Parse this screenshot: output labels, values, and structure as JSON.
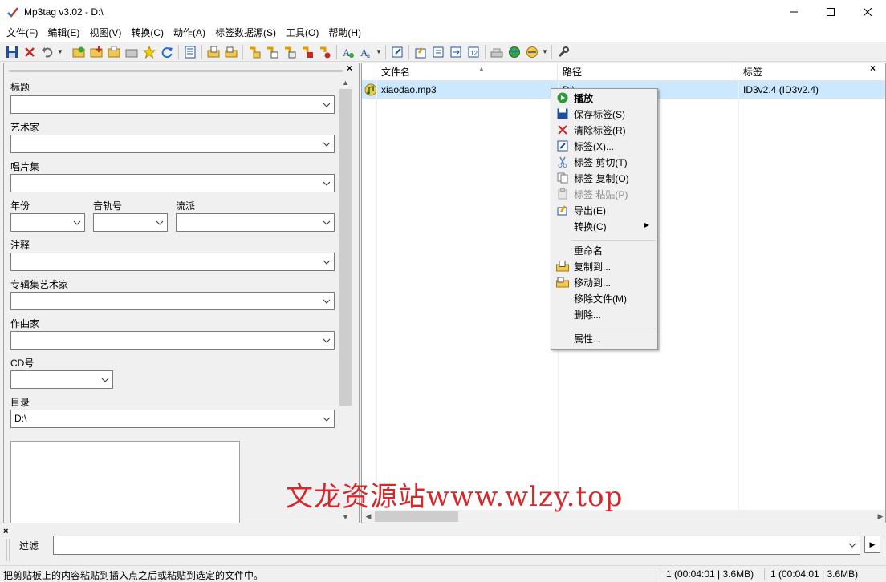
{
  "window": {
    "title": "Mp3tag v3.02  -  D:\\",
    "minimize": "—",
    "maximize": "☐",
    "close": "✕"
  },
  "menu": [
    "文件(F)",
    "编辑(E)",
    "视图(V)",
    "转换(C)",
    "动作(A)",
    "标签数据源(S)",
    "工具(O)",
    "帮助(H)"
  ],
  "tag_panel": {
    "close": "×",
    "fields": {
      "title": {
        "label": "标题",
        "value": ""
      },
      "artist": {
        "label": "艺术家",
        "value": ""
      },
      "album": {
        "label": "唱片集",
        "value": ""
      },
      "year": {
        "label": "年份",
        "value": ""
      },
      "track": {
        "label": "音轨号",
        "value": ""
      },
      "genre": {
        "label": "流派",
        "value": ""
      },
      "comment": {
        "label": "注释",
        "value": ""
      },
      "album_artist": {
        "label": "专辑集艺术家",
        "value": ""
      },
      "composer": {
        "label": "作曲家",
        "value": ""
      },
      "disc": {
        "label": "CD号",
        "value": ""
      },
      "directory": {
        "label": "目录",
        "value": "D:\\"
      }
    }
  },
  "file_list": {
    "close": "×",
    "columns": [
      "文件名",
      "路径",
      "标签"
    ],
    "rows": [
      {
        "filename": "xiaodao.mp3",
        "path": "D:\\",
        "tag": "ID3v2.4 (ID3v2.4)"
      }
    ]
  },
  "context_menu": {
    "items": [
      {
        "label": "播放",
        "icon": "play-icon",
        "bold": true
      },
      {
        "label": "保存标签(S)",
        "icon": "save-icon"
      },
      {
        "label": "清除标签(R)",
        "icon": "remove-icon"
      },
      {
        "label": "标签(X)...",
        "icon": "tag-edit-icon"
      },
      {
        "label": "标签 剪切(T)",
        "icon": "cut-icon"
      },
      {
        "label": "标签 复制(O)",
        "icon": "copy-icon"
      },
      {
        "label": "标签 粘贴(P)",
        "icon": "paste-icon",
        "disabled": true
      },
      {
        "label": "导出(E)",
        "icon": "export-icon"
      },
      {
        "label": "转换(C)",
        "icon": "",
        "submenu": true
      },
      {
        "label": "重命名",
        "icon": ""
      },
      {
        "label": "复制到...",
        "icon": "folder-copy-icon"
      },
      {
        "label": "移动到...",
        "icon": "folder-move-icon"
      },
      {
        "label": "移除文件(M)",
        "icon": ""
      },
      {
        "label": "删除...",
        "icon": ""
      },
      {
        "label": "属性...",
        "icon": ""
      }
    ],
    "submenu_arrow": "▶"
  },
  "filter": {
    "close": "×",
    "label": "过滤",
    "value": "",
    "go": "▶"
  },
  "status": {
    "hint": "把剪贴板上的内容粘贴到插入点之后或粘贴到选定的文件中。",
    "selected": "1 (00:04:01 | 3.6MB)",
    "total": "1 (00:04:01 | 3.6MB)"
  },
  "watermark": "文龙资源站www.wlzy.top",
  "colors": {
    "selection": "#cce8ff",
    "watermark": "#d9262b"
  }
}
